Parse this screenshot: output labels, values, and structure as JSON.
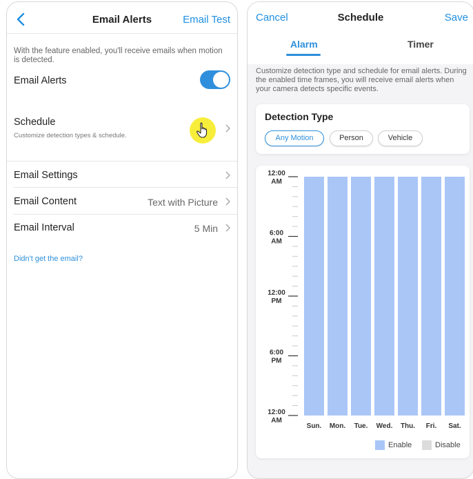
{
  "left": {
    "header": {
      "title": "Email Alerts",
      "right_action": "Email Test"
    },
    "feature_hint": "With the feature enabled, you'll receive emails when motion is detected.",
    "email_alerts": {
      "label": "Email Alerts",
      "enabled": true
    },
    "schedule": {
      "label": "Schedule",
      "sublabel": "Customize detection types & schedule."
    },
    "email_settings": {
      "label": "Email Settings"
    },
    "email_content": {
      "label": "Email Content",
      "value": "Text with Picture"
    },
    "email_interval": {
      "label": "Email Interval",
      "value": "5 Min"
    },
    "help_link": "Didn't get the email?"
  },
  "right": {
    "header": {
      "cancel": "Cancel",
      "title": "Schedule",
      "save": "Save"
    },
    "tabs": [
      {
        "label": "Alarm",
        "active": true
      },
      {
        "label": "Timer",
        "active": false
      }
    ],
    "description": "Customize detection type and schedule for email alerts. During the enabled time frames, you will receive email alerts when your camera detects specific events.",
    "detection": {
      "title": "Detection Type",
      "chips": [
        {
          "label": "Any Motion",
          "selected": true
        },
        {
          "label": "Person",
          "selected": false
        },
        {
          "label": "Vehicle",
          "selected": false
        }
      ]
    },
    "legend": {
      "enable": "Enable",
      "disable": "Disable"
    }
  },
  "colors": {
    "accent": "#2d8fdb",
    "enabled_block": "#a9c6f7",
    "disabled_block": "#dcdcdc",
    "highlight": "#f7ee3c"
  },
  "chart_data": {
    "type": "bar",
    "categories": [
      "Sun.",
      "Mon.",
      "Tue.",
      "Wed.",
      "Thu.",
      "Fri.",
      "Sat."
    ],
    "y_ticks": [
      {
        "line1": "12:00",
        "line2": "AM",
        "hour": 0
      },
      {
        "line1": "6:00",
        "line2": "AM",
        "hour": 6
      },
      {
        "line1": "12:00",
        "line2": "PM",
        "hour": 12
      },
      {
        "line1": "6:00",
        "line2": "PM",
        "hour": 18
      },
      {
        "line1": "12:00",
        "line2": "AM",
        "hour": 24
      }
    ],
    "ylim": [
      0,
      24
    ],
    "enabled_ranges": [
      {
        "day": "Sun.",
        "start": 0,
        "end": 24
      },
      {
        "day": "Mon.",
        "start": 0,
        "end": 24
      },
      {
        "day": "Tue.",
        "start": 0,
        "end": 24
      },
      {
        "day": "Wed.",
        "start": 0,
        "end": 24
      },
      {
        "day": "Thu.",
        "start": 0,
        "end": 24
      },
      {
        "day": "Fri.",
        "start": 0,
        "end": 24
      },
      {
        "day": "Sat.",
        "start": 0,
        "end": 24
      }
    ]
  }
}
